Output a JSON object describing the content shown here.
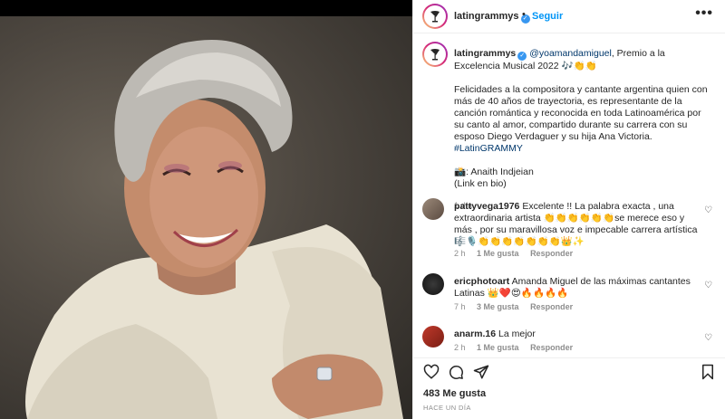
{
  "post": {
    "username": "latingrammys",
    "follow_label": "Seguir",
    "more_label": "•••",
    "separator": "•"
  },
  "caption": {
    "username": "latingrammys",
    "mention": "@yoamandamiguel",
    "line1_rest": ", Premio a la Excelencia Musical 2022 🎶👏👏",
    "body": "Felicidades a la compositora y cantante argentina quien con más de 40 años de trayectoria, es representante de la canción romántica y reconocida en toda Latinoamérica por su canto al amor, compartido durante su carrera con su esposo Diego Verdaguer y su hija Ana Victoria.",
    "hashtag": "#LatinGRAMMY",
    "credit": "📸: Anaith Indjeian",
    "link_note": "(Link en bio)",
    "time": "1 día"
  },
  "comments": [
    {
      "username": "pattyvega1976",
      "text": "Excelente !! La palabra exacta , una extraordinaria artista 👏👏👏👏👏👏se merece eso y más , por su maravillosa voz e impecable carrera artística 🎼🎙️👏👏👏👏👏👏👏👑✨",
      "time": "2 h",
      "likes": "1 Me gusta",
      "reply": "Responder"
    },
    {
      "username": "ericphotoart",
      "text": "Amanda Miguel de las máximas cantantes Latinas 👑❤️😍🔥🔥🔥🔥",
      "time": "7 h",
      "likes": "3 Me gusta",
      "reply": "Responder"
    },
    {
      "username": "anarm.16",
      "text": "La mejor",
      "time": "2 h",
      "likes": "1 Me gusta",
      "reply": "Responder"
    }
  ],
  "footer": {
    "likes": "483 Me gusta",
    "ago": "HACE UN DÍA"
  },
  "colors": {
    "link_blue": "#0095f6",
    "verified_blue": "#3897f0",
    "muted_gray": "#8e8e8e"
  }
}
